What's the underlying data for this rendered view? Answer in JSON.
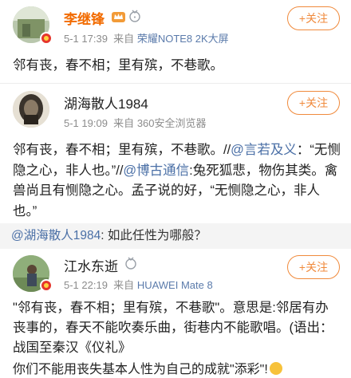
{
  "post1": {
    "name": "李继锋",
    "time": "5-1 17:39",
    "source_prefix": "来自",
    "source": "荣耀NOTE8 2K大屏",
    "follow_label": "+关注",
    "content": "邻有丧，春不相；里有殡，不巷歌。"
  },
  "post2": {
    "name": "湖海散人1984",
    "time": "5-1 19:09",
    "source_prefix": "来自",
    "source": "360安全浏览器",
    "follow_label": "+关注",
    "content_a": "邻有丧，春不相；里有殡，不巷歌。//",
    "mention_a": "@言若及义",
    "content_b": "：“无恻隐之心，非人也。”//",
    "mention_b": "@博古通信",
    "content_c": ":兔死狐悲，物伤其类。禽兽尚且有恻隐之心。孟子说的好，“无恻隐之心，非人也。”"
  },
  "quote": {
    "mention": "@湖海散人1984",
    "text": ": 如此任性为哪般？"
  },
  "post3": {
    "name": "江水东逝",
    "time": "5-1 22:19",
    "source_prefix": "来自",
    "source": "HUAWEI Mate 8",
    "follow_label": "+关注",
    "content": "\"邻有丧，春不相；里有殡，不巷歌\"。意思是:邻居有办丧事的，春天不能吹奏乐曲，街巷内不能歌唱。(语出：战国至秦汉《仪礼》",
    "content_last": "你们不能用丧失基本人性为自己的成就\"添彩\"!"
  },
  "colors": {
    "accent": "#f08a3c",
    "link": "#4a6fa6",
    "vip_name": "#f26b00"
  }
}
